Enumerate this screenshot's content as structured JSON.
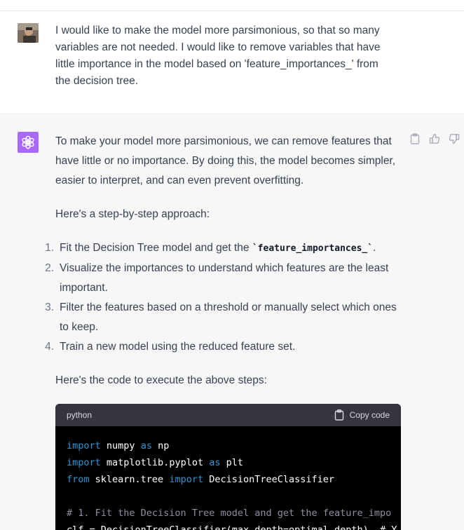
{
  "user_message": {
    "text": "I would like to make the model more parsimonious, so that so many variables are not needed. I would like to remove variables that have little importance in the model based on 'feature_importances_' from the decision tree."
  },
  "assistant_message": {
    "intro": "To make your model more parsimonious, we can remove features that have little or no importance. By doing this, the model becomes simpler, easier to interpret, and can even prevent overfitting.",
    "approach_label": "Here's a step-by-step approach:",
    "steps": [
      {
        "num": "1.",
        "text_before": "Fit the Decision Tree model and get the ",
        "code": "`feature_importances_`",
        "text_after": "."
      },
      {
        "num": "2.",
        "text": "Visualize the importances to understand which features are the least important."
      },
      {
        "num": "3.",
        "text": "Filter the features based on a threshold or manually select which ones to keep."
      },
      {
        "num": "4.",
        "text": "Train a new model using the reduced feature set."
      }
    ],
    "code_intro": "Here's the code to execute the above steps:",
    "code_block": {
      "language": "python",
      "copy_label": "Copy code",
      "lines": [
        {
          "kw1": "import",
          "rest1": " numpy ",
          "kw2": "as",
          "rest2": " np"
        },
        {
          "kw1": "import",
          "rest1": " matplotlib.pyplot ",
          "kw2": "as",
          "rest2": " plt"
        },
        {
          "kw1": "from",
          "rest1": " sklearn.tree ",
          "kw2": "import",
          "rest2": " DecisionTreeClassifier"
        },
        {
          "comment": "# 1. Fit the Decision Tree model and get the feature_impo"
        },
        {
          "plain": "clf = DecisionTreeClassifier(max_depth=optimal_depth)  # Y"
        }
      ]
    },
    "actions": [
      "copy-icon",
      "thumbs-up-icon",
      "thumbs-down-icon"
    ]
  },
  "colors": {
    "assistant_bg": "#f7f7f8",
    "bot_avatar": "#ab68ff",
    "code_bg": "#000000",
    "code_header": "#343541",
    "keyword": "#2e95d3"
  }
}
